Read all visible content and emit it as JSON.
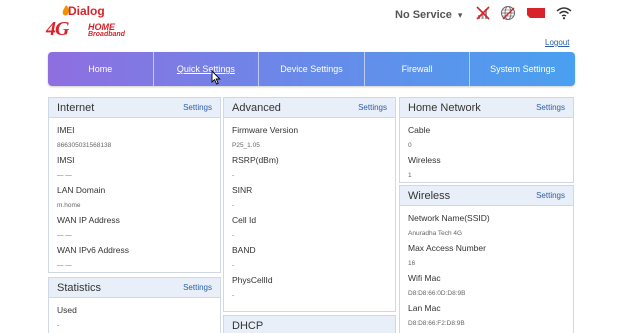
{
  "header": {
    "brand": "Dialog",
    "logo_4g": "4G",
    "logo_line1": "HOME",
    "logo_line2": "Broadband",
    "service_status": "No Service",
    "dropdown_caret": "▾",
    "logout": "Logout",
    "icons": [
      "no-signal-icon",
      "globe-icon",
      "sim-card-icon",
      "wifi-icon"
    ],
    "colors": {
      "brand_red": "#d8232a",
      "link_blue": "#2a5ea8"
    }
  },
  "nav": {
    "items": [
      "Home",
      "Quick Settings",
      "Device Settings",
      "Firewall",
      "System Settings"
    ],
    "active": "Quick Settings"
  },
  "internet": {
    "title": "Internet",
    "link": "Settings",
    "rows": [
      {
        "label": "IMEI",
        "value": "866305031568138"
      },
      {
        "label": "IMSI",
        "value": "— —"
      },
      {
        "label": "LAN Domain",
        "value": "m.home"
      },
      {
        "label": "WAN IP Address",
        "value": "— —"
      },
      {
        "label": "WAN IPv6 Address",
        "value": "— —"
      }
    ]
  },
  "statistics": {
    "title": "Statistics",
    "link": "Settings",
    "rows": [
      {
        "label": "Used",
        "value": "-"
      }
    ]
  },
  "advanced": {
    "title": "Advanced",
    "link": "Settings",
    "rows": [
      {
        "label": "Firmware Version",
        "value": "P25_1.05"
      },
      {
        "label": "RSRP(dBm)",
        "value": "-"
      },
      {
        "label": "SINR",
        "value": "-"
      },
      {
        "label": "Cell Id",
        "value": "-"
      },
      {
        "label": "BAND",
        "value": "-"
      },
      {
        "label": "PhysCellId",
        "value": "-"
      }
    ]
  },
  "dhcp": {
    "title": "DHCP"
  },
  "home_network": {
    "title": "Home Network",
    "link": "Settings",
    "rows": [
      {
        "label": "Cable",
        "value": "0"
      },
      {
        "label": "Wireless",
        "value": "1"
      }
    ]
  },
  "wireless": {
    "title": "Wireless",
    "link": "Settings",
    "rows": [
      {
        "label": "Network Name(SSID)",
        "value": "Anuradha Tech 4G"
      },
      {
        "label": "Max Access Number",
        "value": "16"
      },
      {
        "label": "Wifi Mac",
        "value": "D8:D8:66:0D:D8:9B"
      },
      {
        "label": "Lan Mac",
        "value": "D8:D8:66:F2:D8:9B"
      }
    ]
  }
}
